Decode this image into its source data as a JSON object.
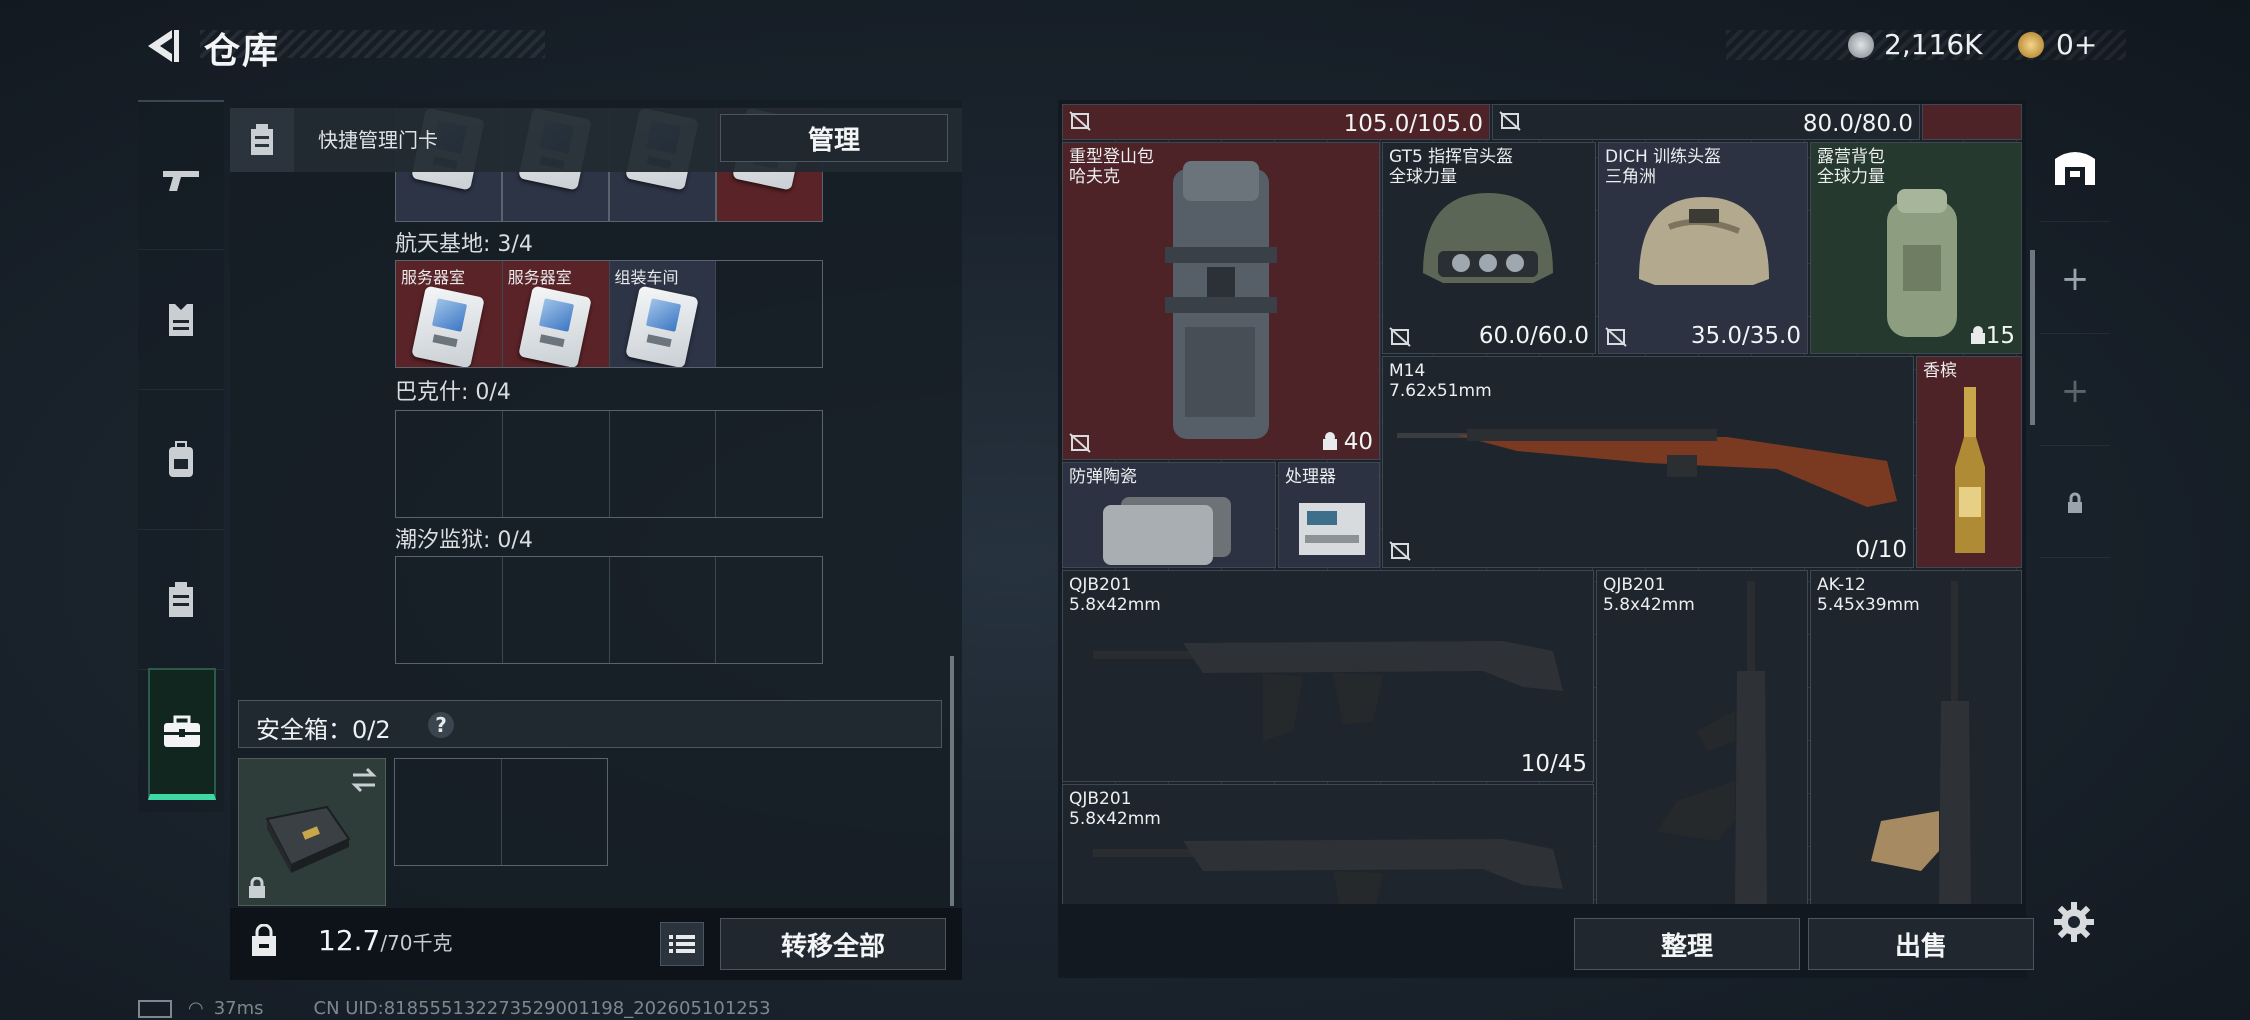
{
  "header": {
    "title": "仓库",
    "currency1": "2,116K",
    "currency2": "0+"
  },
  "left_nav": {
    "items": [
      "gun-icon",
      "armor-icon",
      "backpack-icon",
      "chest-rig-icon",
      "briefcase-icon"
    ],
    "active": "briefcase-icon"
  },
  "keycard_panel": {
    "title": "快捷管理门卡",
    "manage_button": "管理",
    "sections": [
      {
        "label": "航天基地: 3/4",
        "cells": [
          "服务器室",
          "服务器室",
          "组装车间",
          ""
        ]
      },
      {
        "label": "巴克什: 0/4",
        "cells": [
          "",
          "",
          "",
          ""
        ]
      },
      {
        "label": "潮汐监狱: 0/4",
        "cells": [
          "",
          "",
          "",
          ""
        ]
      }
    ]
  },
  "safebox": {
    "title": "安全箱：0/2",
    "help": "?"
  },
  "footer_left": {
    "weight": "12.7",
    "capacity": "/70千克",
    "transfer_button": "转移全部"
  },
  "inventory": {
    "top_stats": [
      "105.0/105.0",
      "80.0/80.0"
    ],
    "items": [
      {
        "name": "重型登山包\n哈夫克",
        "stat": "40"
      },
      {
        "name": "GT5 指挥官头盔\n全球力量",
        "stat": "60.0/60.0"
      },
      {
        "name": "DICH 训练头盔\n三角洲",
        "stat": "35.0/35.0"
      },
      {
        "name": "露营背包\n全球力量",
        "stat": "15"
      },
      {
        "name": "M14\n7.62x51mm",
        "stat": "0/10"
      },
      {
        "name": "香槟",
        "stat": ""
      },
      {
        "name": "防弹陶瓷",
        "stat": ""
      },
      {
        "name": "处理器",
        "stat": ""
      },
      {
        "name": "QJB201\n5.8x42mm",
        "stat": "10/45"
      },
      {
        "name": "QJB201\n5.8x42mm",
        "stat": ""
      },
      {
        "name": "AK-12\n5.45x39mm",
        "stat": ""
      },
      {
        "name": "QJB201\n5.8x42mm",
        "stat": ""
      }
    ],
    "sort_button": "整理",
    "sell_button": "出售"
  },
  "status_bar": {
    "ping": "37ms",
    "uid": "CN UID:818555132273529001198_202605101253"
  },
  "colors": {
    "accent": "#3fd8a4",
    "item_red": "#4e2327",
    "item_blue": "#2c3242",
    "item_green": "#26392f"
  }
}
